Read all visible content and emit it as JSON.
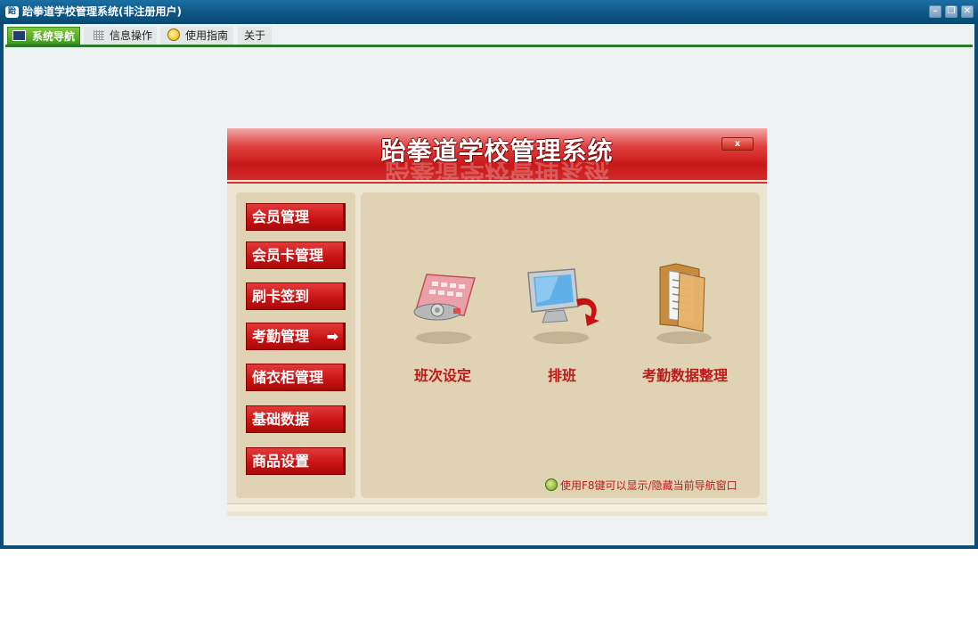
{
  "window": {
    "title": "跆拳道学校管理系统(非注册用户)",
    "app_icon": "跆",
    "controls": {
      "minimize": "–",
      "maximize": "❐",
      "close": "✕"
    }
  },
  "tabs": [
    {
      "label": "系统导航",
      "icon": "monitor-icon",
      "active": true
    },
    {
      "label": "信息操作",
      "icon": "grid-icon",
      "active": false
    },
    {
      "label": "使用指南",
      "icon": "help-icon",
      "active": false
    },
    {
      "label": "关于",
      "icon": "",
      "active": false
    }
  ],
  "nav": {
    "title": "跆拳道学校管理系统",
    "close_label": "x",
    "menu": [
      {
        "label": "会员管理"
      },
      {
        "label": "会员卡管理"
      },
      {
        "label": "刷卡签到"
      },
      {
        "label": "考勤管理",
        "selected": true,
        "arrow": "➡"
      },
      {
        "label": "储衣柜管理"
      },
      {
        "label": "基础数据"
      },
      {
        "label": "商品设置"
      }
    ],
    "functions": [
      {
        "label": "班次设定",
        "icon": "schedule-keypad-icon"
      },
      {
        "label": "排班",
        "icon": "monitor-arrow-icon"
      },
      {
        "label": "考勤数据整理",
        "icon": "folder-document-icon"
      }
    ],
    "tip": "使用F8键可以显示/隐藏当前导航窗口"
  },
  "colors": {
    "titlebar": "#0e5685",
    "accent_red": "#c81212",
    "panel": "#dfd3b3",
    "active_tab": "#3f9a1c"
  }
}
